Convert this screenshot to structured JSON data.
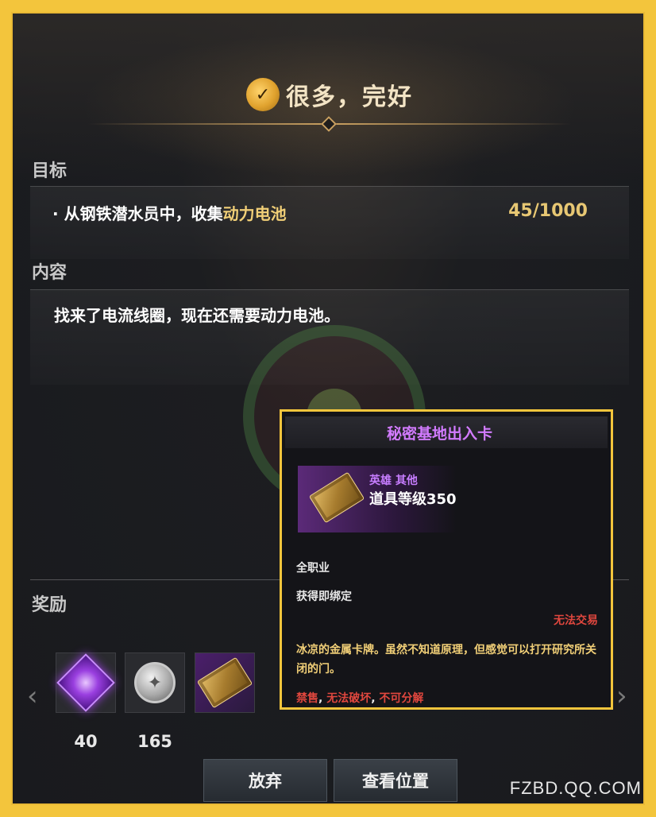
{
  "quest": {
    "title": "很多，完好",
    "title_icon": "quest-badge-icon"
  },
  "objective": {
    "section_label": "目标",
    "bullet": "·",
    "text_prefix": "从钢铁潜水员中，收集",
    "text_highlight": "动力电池",
    "progress": "45/1000"
  },
  "content": {
    "section_label": "内容",
    "text": "找来了电流线圈，现在还需要动力电池。"
  },
  "rewards": {
    "section_label": "奖励",
    "items": [
      {
        "icon": "purple-gem-icon",
        "count": "40"
      },
      {
        "icon": "silver-coins-icon",
        "count": "165"
      },
      {
        "icon": "access-card-icon",
        "count": ""
      }
    ],
    "prev_arrow": "‹",
    "next_arrow": "›"
  },
  "buttons": {
    "abandon": "放弃",
    "view_location": "查看位置"
  },
  "tooltip": {
    "name": "秘密基地出入卡",
    "rarity": "英雄 其他",
    "item_level": "道具等级350",
    "class": "全职业",
    "bind": "获得即绑定",
    "trade": "无法交易",
    "description": "冰凉的金属卡牌。虽然不知道原理，但感觉可以打开研究所关闭的门。",
    "flag_1": "禁售",
    "flag_2": "无法破坏",
    "flag_3": "不可分解",
    "flag_sep": ", "
  },
  "site": "FZBD.QQ.COM",
  "colors": {
    "frame_border": "#f3c53c",
    "highlight_gold": "#f1cf77",
    "hero_purple": "#c77dff",
    "warning_red": "#e0473e"
  }
}
